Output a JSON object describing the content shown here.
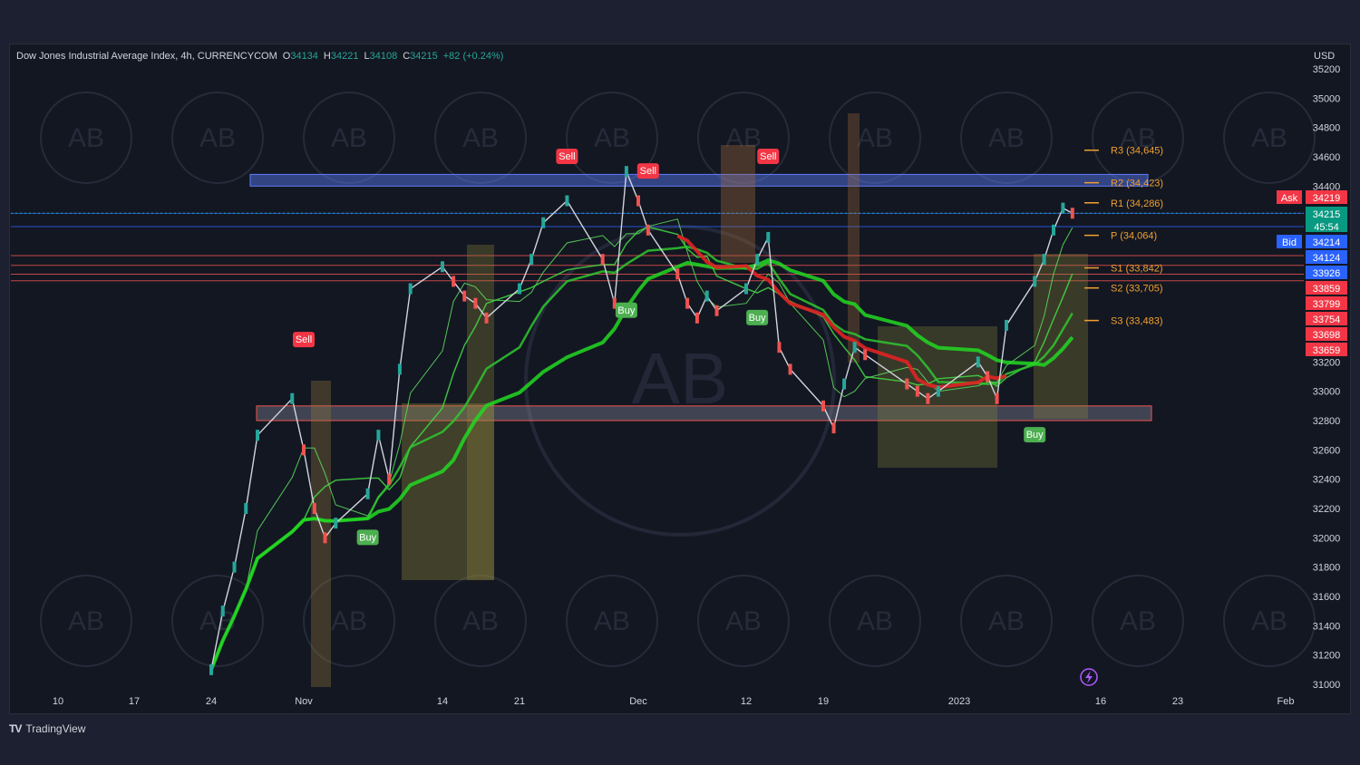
{
  "header": {
    "symbol": "Dow Jones Industrial Average Index, 4h, CURRENCYCOM",
    "open_label": "O",
    "open": "34134",
    "high_label": "H",
    "high": "34221",
    "low_label": "L",
    "low": "34108",
    "close_label": "C",
    "close": "34215",
    "change": "+82 (+0.24%)",
    "currency": "USD"
  },
  "footer": {
    "brand": "TradingView",
    "brand_logo": "TV"
  },
  "watermark": {
    "text": "AB"
  },
  "colors": {
    "background": "#131722",
    "bull": "#26a69a",
    "bear": "#ef5350",
    "ma_green": "#3cd63c",
    "ma_red": "#e02424",
    "pivot": "#f0a030",
    "zone_blue": "#5c7cfa",
    "zone_red": "#ef5350",
    "bid": "#2962ff",
    "ask": "#f23645"
  },
  "chart_data": {
    "type": "line",
    "title": "Dow Jones Industrial Average Index, 4h, CURRENCYCOM",
    "xlabel": "",
    "ylabel": "",
    "ylim": [
      30900,
      35200
    ],
    "grid": false,
    "x_ticks": [
      "10",
      "17",
      "24",
      "Nov",
      "14",
      "21",
      "Dec",
      "12",
      "19",
      "2023",
      "16",
      "23",
      "Feb"
    ],
    "y_ticks": [
      35200,
      35000,
      34800,
      34600,
      34400,
      34200,
      34000,
      33800,
      33600,
      33400,
      33200,
      33000,
      32800,
      32600,
      32400,
      32200,
      32000,
      31800,
      31600,
      31400,
      31200,
      31000
    ],
    "series": [
      {
        "x": [
          "Oct 24",
          "Oct 25",
          "Oct 26",
          "Oct 27",
          "Oct 28",
          "Oct 31",
          "Nov 1",
          "Nov 2",
          "Nov 3",
          "Nov 4",
          "Nov 7",
          "Nov 8",
          "Nov 9",
          "Nov 10",
          "Nov 11",
          "Nov 14",
          "Nov 15",
          "Nov 16",
          "Nov 17",
          "Nov 18",
          "Nov 21",
          "Nov 22",
          "Nov 23",
          "Nov 25",
          "Nov 28",
          "Nov 29",
          "Nov 30",
          "Dec 1",
          "Dec 2",
          "Dec 5",
          "Dec 6",
          "Dec 7",
          "Dec 8",
          "Dec 9",
          "Dec 12",
          "Dec 13",
          "Dec 14",
          "Dec 15",
          "Dec 16",
          "Dec 19",
          "Dec 20",
          "Dec 21",
          "Dec 22",
          "Dec 23",
          "Dec 27",
          "Dec 28",
          "Dec 29",
          "Dec 30",
          "Jan 3",
          "Jan 4",
          "Jan 5",
          "Jan 6",
          "Jan 9",
          "Jan 10",
          "Jan 11",
          "Jan 12",
          "Jan 13"
        ],
        "values": [
          31100,
          31500,
          31800,
          32200,
          32700,
          32950,
          32600,
          32200,
          32000,
          32100,
          32300,
          32700,
          32400,
          33150,
          33700,
          33850,
          33750,
          33650,
          33600,
          33500,
          33700,
          33900,
          34150,
          34300,
          33900,
          33600,
          34500,
          34300,
          34100,
          33800,
          33600,
          33500,
          33650,
          33550,
          33700,
          33900,
          34050,
          33300,
          33150,
          32900,
          32750,
          33050,
          33300,
          33250,
          33050,
          33000,
          32950,
          33000,
          33200,
          33100,
          32950,
          33450,
          33750,
          33900,
          34100,
          34250,
          34215
        ]
      }
    ],
    "pivots": [
      {
        "label": "R3 (34,645)",
        "value": 34645
      },
      {
        "label": "R2 (34,423)",
        "value": 34423
      },
      {
        "label": "R1 (34,286)",
        "value": 34286
      },
      {
        "label": "P (34,064)",
        "value": 34064
      },
      {
        "label": "S1 (33,842)",
        "value": 33842
      },
      {
        "label": "S2 (33,705)",
        "value": 33705
      },
      {
        "label": "S3 (33,483)",
        "value": 33483
      }
    ],
    "signals": [
      {
        "label": "Sell",
        "date": "Nov 1",
        "price": 33350
      },
      {
        "label": "Buy",
        "date": "Nov 7",
        "price": 32000
      },
      {
        "label": "Sell",
        "date": "Nov 25",
        "price": 34600
      },
      {
        "label": "Buy",
        "date": "Nov 30",
        "price": 33550
      },
      {
        "label": "Sell",
        "date": "Dec 2",
        "price": 34500
      },
      {
        "label": "Buy",
        "date": "Dec 13",
        "price": 33500
      },
      {
        "label": "Sell",
        "date": "Dec 14",
        "price": 34600
      },
      {
        "label": "Buy",
        "date": "Jan 9",
        "price": 32700
      }
    ],
    "zones": [
      {
        "type": "resistance",
        "from": 34400,
        "to": 34480
      },
      {
        "type": "support",
        "from": 32820,
        "to": 32900
      }
    ],
    "price_tags": [
      {
        "value": "34219",
        "label": "Ask"
      },
      {
        "value": "34215",
        "sub": "45:54"
      },
      {
        "value": "34214",
        "label": "Bid"
      },
      {
        "value": "34124"
      },
      {
        "value": "33926"
      },
      {
        "value": "33859"
      },
      {
        "value": "33799"
      },
      {
        "value": "33754"
      },
      {
        "value": "33698"
      },
      {
        "value": "33659"
      }
    ]
  }
}
